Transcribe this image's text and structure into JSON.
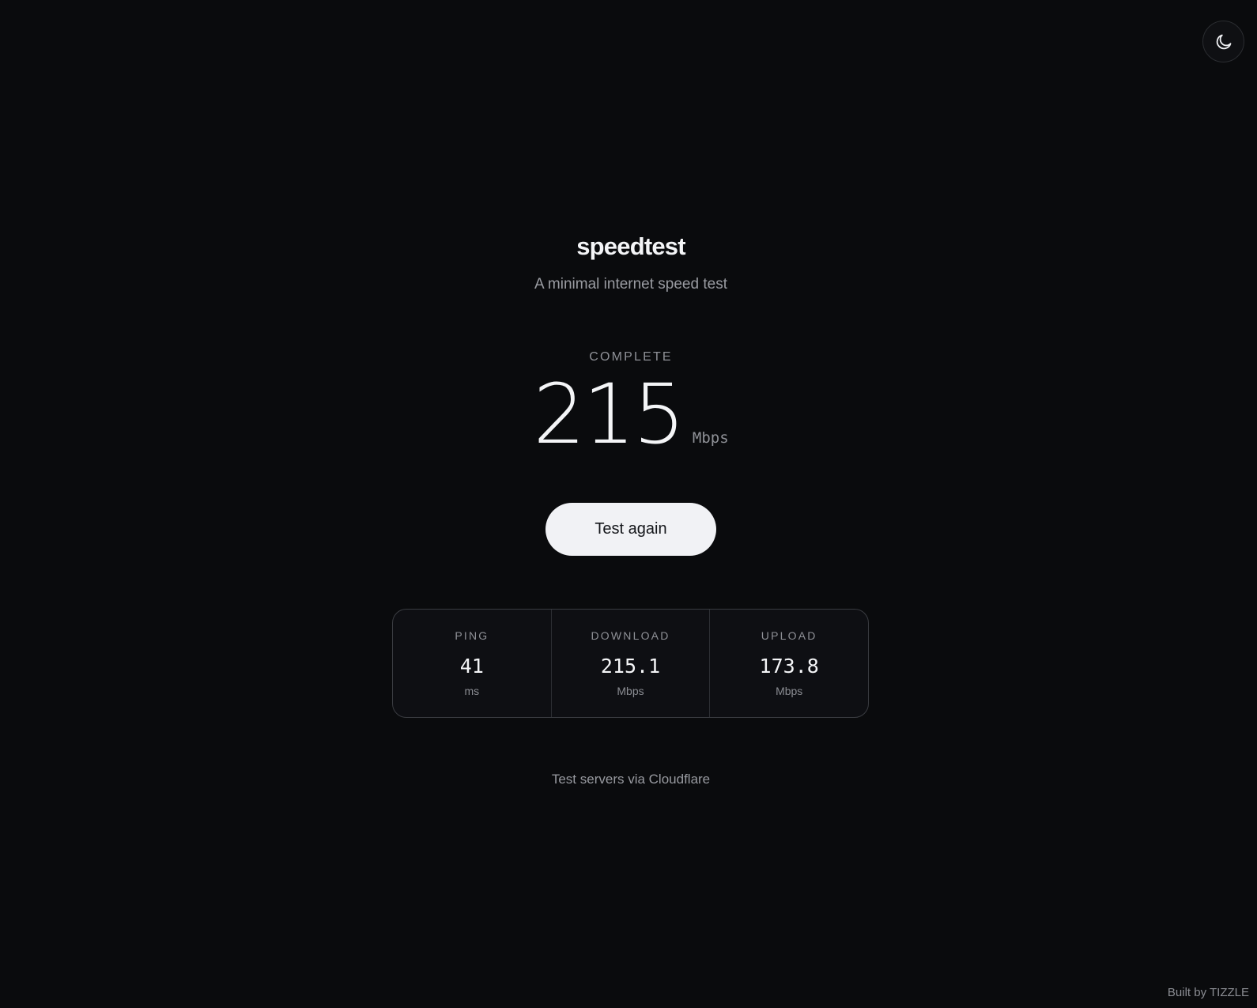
{
  "theme_toggle": {
    "icon": "moon-icon"
  },
  "header": {
    "title": "speedtest",
    "subtitle": "A minimal internet speed test"
  },
  "result": {
    "status": "COMPLETE",
    "speed": "215",
    "unit": "Mbps"
  },
  "actions": {
    "test_again_label": "Test again"
  },
  "stats": [
    {
      "label": "PING",
      "value": "41",
      "unit": "ms"
    },
    {
      "label": "DOWNLOAD",
      "value": "215.1",
      "unit": "Mbps"
    },
    {
      "label": "UPLOAD",
      "value": "173.8",
      "unit": "Mbps"
    }
  ],
  "footer": {
    "servers_note": "Test servers via Cloudflare",
    "credit": "Built by TIZZLE"
  },
  "colors": {
    "background": "#0a0b0d",
    "button_bg": "#f1f2f5",
    "primary_text": "#f4f5f7",
    "muted_text": "#8f9197"
  }
}
